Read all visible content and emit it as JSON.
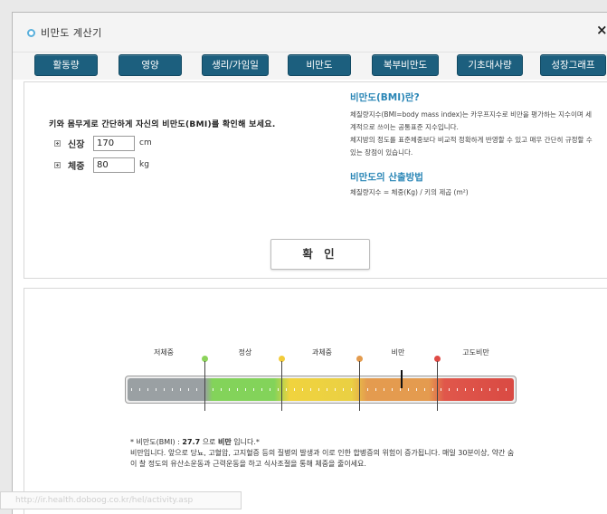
{
  "window": {
    "title": "비만도 계산기",
    "close_label": "×"
  },
  "tabs": [
    {
      "label": "활동량"
    },
    {
      "label": "영양"
    },
    {
      "label": "생리/가임일"
    },
    {
      "label": "비만도"
    },
    {
      "label": "복부비만도"
    },
    {
      "label": "기초대사량"
    },
    {
      "label": "성장그래프"
    }
  ],
  "calculator": {
    "prompt": "키와 몸무게로 간단하게 자신의 비만도(BMI)를 확인해 보세요.",
    "height": {
      "label": "신장",
      "value": "170",
      "unit": "cm"
    },
    "weight": {
      "label": "체중",
      "value": "80",
      "unit": "kg"
    },
    "confirm_label": "확 인"
  },
  "info": {
    "what_title": "비만도(BMI)란?",
    "what_body": "체질량지수(BMI=body mass index)는 카우프지수로 비만을 평가하는 지수이며 세계적으로 쓰이는 공통표준 지수입니다.\n체지방의 정도를 표준체중보다 비교적 정확하게 반영할 수 있고 매우 간단히 규정할 수 있는 장점이 있습니다.",
    "method_title": "비만도의 산출방법",
    "method_body": "체질량지수 = 체중(Kg) / 키의 제곱 (m²)"
  },
  "gauge": {
    "categories": [
      {
        "label": "저체중",
        "color": ""
      },
      {
        "label": "정상",
        "color": "#8cd35a"
      },
      {
        "label": "과체중",
        "color": "#f2cc3a"
      },
      {
        "label": "비만",
        "color": "#e39b4e"
      },
      {
        "label": "고도비만",
        "color": "#df4a46"
      }
    ],
    "bmi_value": 27.7
  },
  "result": {
    "prefix": "* 비만도(BMI) : ",
    "bmi": "27.7",
    "mid": " 으로 ",
    "category": "비만",
    "suffix": " 입니다.*",
    "description": "비만입니다. 앞으로 당뇨, 고혈압, 고지혈증 등의 질병의 발생과 이로 인한 합병증의 위험이 증가됩니다. 매일 30분이상, 약간 숨이 찰 정도의 유산소운동과 근력운동을 하고 식사조절을 통해 체중을 줄이세요."
  },
  "status_bar": {
    "url": "http://ir.health.doboog.co.kr/hel/activity.asp"
  }
}
